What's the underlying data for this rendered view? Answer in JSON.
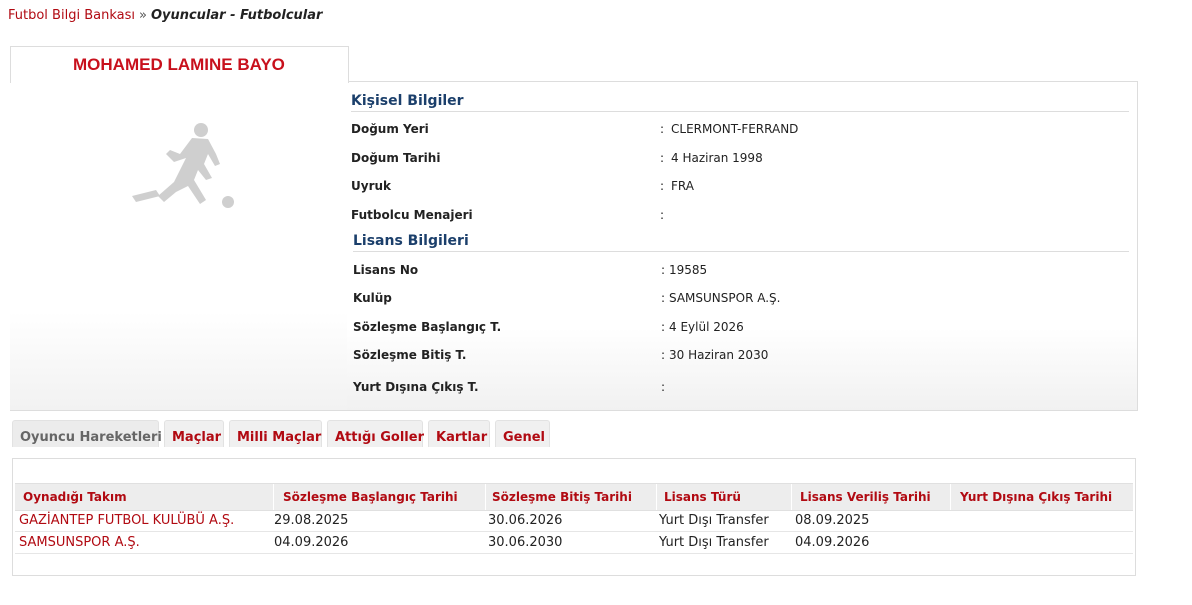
{
  "breadcrumb": {
    "home": "Futbol Bilgi Bankası",
    "separator": "»",
    "current": "Oyuncular - Futbolcular"
  },
  "player": {
    "name": "MOHAMED LAMINE BAYO",
    "avatar_icon": "player-silhouette-icon"
  },
  "personal": {
    "title": "Kişisel Bilgiler",
    "fields": [
      {
        "label": "Doğum Yeri",
        "value": "CLERMONT-FERRAND"
      },
      {
        "label": "Doğum Tarihi",
        "value": "4 Haziran 1998"
      },
      {
        "label": "Uyruk",
        "value": "FRA"
      },
      {
        "label": "Futbolcu Menajeri",
        "value": ""
      }
    ]
  },
  "license": {
    "title": "Lisans Bilgileri",
    "fields": [
      {
        "label": "Lisans No",
        "value": "19585"
      },
      {
        "label": "Kulüp",
        "value": "SAMSUNSPOR A.Ş."
      },
      {
        "label": "Sözleşme Başlangıç T.",
        "value": "4 Eylül 2026"
      },
      {
        "label": "Sözleşme Bitiş T.",
        "value": "30 Haziran 2030"
      },
      {
        "label": "Yurt Dışına Çıkış T.",
        "value": ""
      }
    ]
  },
  "colon": ":",
  "tabs": [
    {
      "label": "Oyuncu Hareketleri",
      "active": true
    },
    {
      "label": "Maçlar"
    },
    {
      "label": "Milli Maçlar"
    },
    {
      "label": "Attığı Goller"
    },
    {
      "label": "Kartlar"
    },
    {
      "label": "Genel"
    }
  ],
  "movements": {
    "columns": [
      "Oynadığı Takım",
      "Sözleşme Başlangıç Tarihi",
      "Sözleşme Bitiş Tarihi",
      "Lisans Türü",
      "Lisans Veriliş Tarihi",
      "Yurt Dışına Çıkış Tarihi"
    ],
    "rows": [
      [
        "GAZİANTEP FUTBOL KULÜBÜ A.Ş.",
        "29.08.2025",
        "30.06.2026",
        "Yurt Dışı Transfer",
        "08.09.2025",
        ""
      ],
      [
        "SAMSUNSPOR A.Ş.",
        "04.09.2026",
        "30.06.2030",
        "Yurt Dışı Transfer",
        "04.09.2026",
        ""
      ]
    ]
  },
  "colors": {
    "accent_red": "#b10a12",
    "name_red": "#c8101c",
    "section_blue": "#1b3f6b"
  }
}
